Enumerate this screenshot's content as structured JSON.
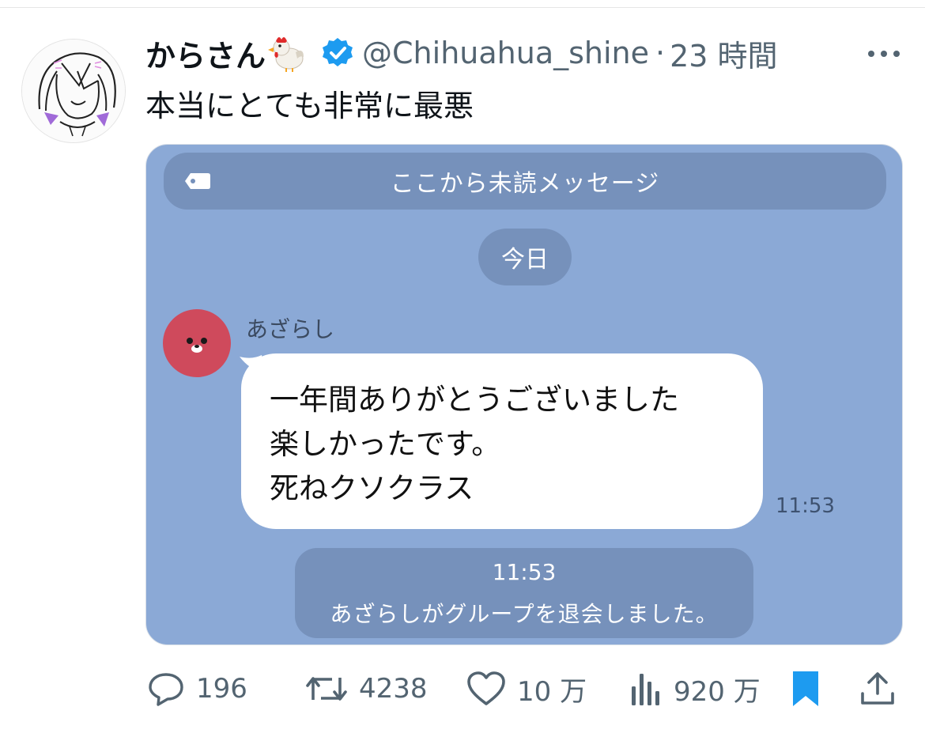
{
  "tweet": {
    "display_name": "からさん",
    "handle": "@Chihuahua_shine",
    "separator": "·",
    "time_ago": "23 時間",
    "text": "本当にとても非常に最悪"
  },
  "chat_screenshot": {
    "unread_banner": "ここから未読メッセージ",
    "date_label": "今日",
    "sender_name": "あざらし",
    "message_lines": [
      "一年間ありがとうございました",
      "楽しかったです。",
      "死ねクソクラス"
    ],
    "message_time": "11:53",
    "notice_time": "11:53",
    "notice_text": "あざらしがグループを退会しました。",
    "colors": {
      "background": "#8ba9d6",
      "pill": "#7691bb",
      "seal_avatar": "#cf4a5c"
    }
  },
  "actions": {
    "replies": "196",
    "retweets": "4238",
    "likes": "10 万",
    "views": "920 万"
  },
  "icons": {
    "more": "more-horizontal-icon",
    "verified": "verified-badge-icon",
    "reply": "reply-icon",
    "retweet": "retweet-icon",
    "like": "heart-icon",
    "views": "views-icon",
    "bookmark": "bookmark-icon",
    "share": "share-icon"
  },
  "accent_color": "#1d9bf0"
}
